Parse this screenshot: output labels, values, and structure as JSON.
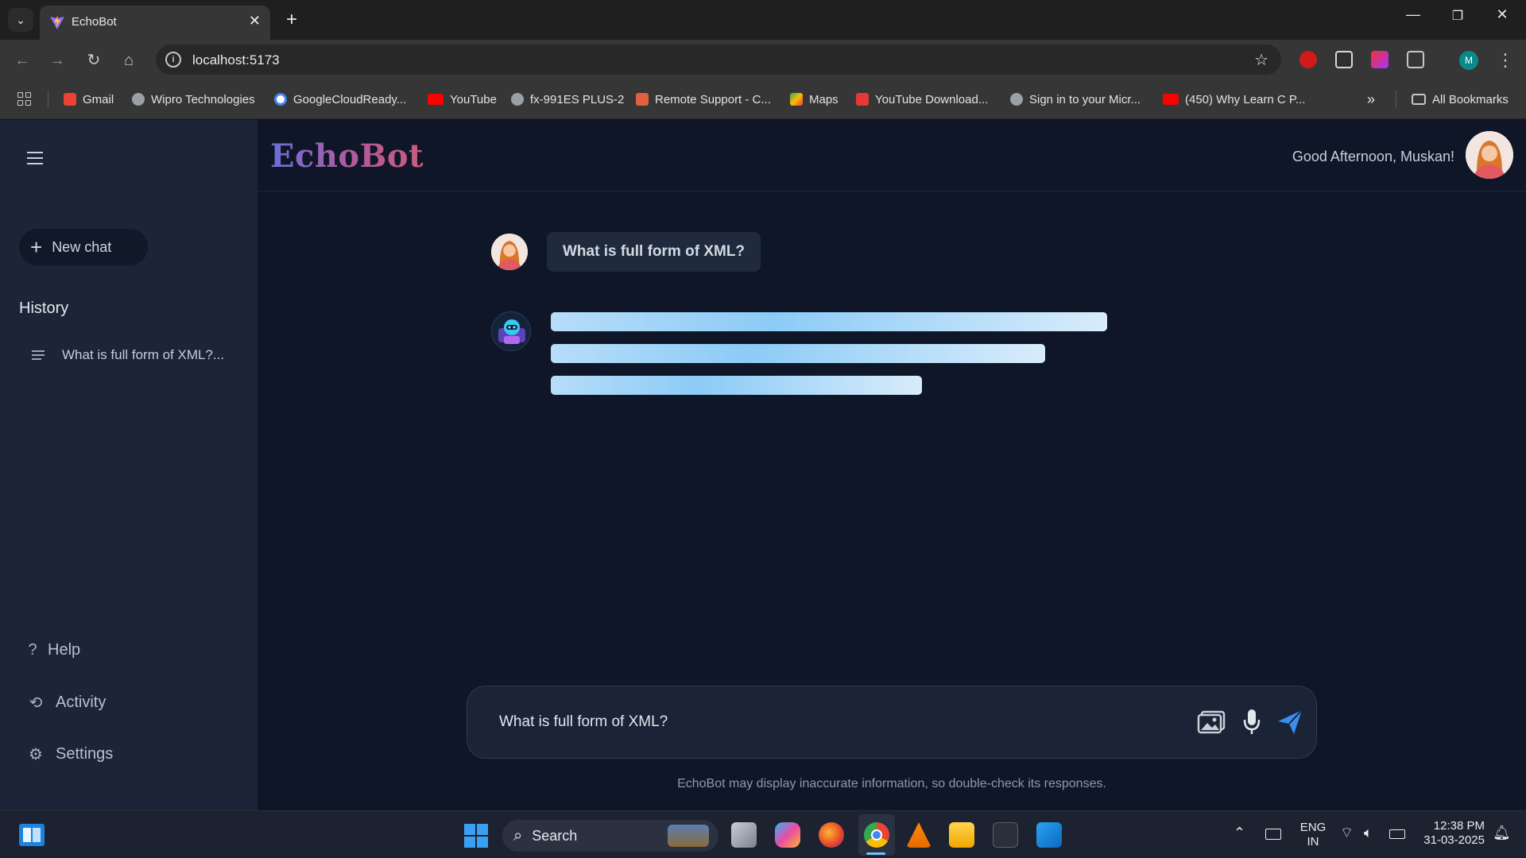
{
  "browser": {
    "tab_title": "EchoBot",
    "url": "localhost:5173",
    "bookmarks": [
      {
        "label": "Gmail",
        "color": "#ea4335"
      },
      {
        "label": "Wipro Technologies",
        "color": "#9aa0a6"
      },
      {
        "label": "GoogleCloudReady...",
        "color": "#4285f4"
      },
      {
        "label": "YouTube",
        "color": "#ff0000"
      },
      {
        "label": "fx-991ES PLUS-2",
        "color": "#9aa0a6"
      },
      {
        "label": "Remote Support - C...",
        "color": "#e06040"
      },
      {
        "label": "Maps",
        "color": "#34a853"
      },
      {
        "label": "YouTube Download...",
        "color": "#e53935"
      },
      {
        "label": "Sign in to your Micr...",
        "color": "#9aa0a6"
      },
      {
        "label": "(450) Why Learn C P...",
        "color": "#ff0000"
      }
    ],
    "all_bookmarks": "All Bookmarks",
    "profile_initial": "M"
  },
  "app": {
    "logo": "EchoBot",
    "greeting": "Good Afternoon, Muskan!",
    "sidebar": {
      "new_chat": "New chat",
      "history_title": "History",
      "history_items": [
        "What is full form of XML?..."
      ],
      "help": "Help",
      "activity": "Activity",
      "settings": "Settings"
    },
    "conversation": {
      "user_message": "What is full form of XML?"
    },
    "input": {
      "value": "What is full form of XML?"
    },
    "disclaimer": "EchoBot may display inaccurate information, so double-check its responses."
  },
  "taskbar": {
    "search": "Search",
    "lang_top": "ENG",
    "lang_bottom": "IN",
    "time": "12:38 PM",
    "date": "31-03-2025"
  },
  "colors": {
    "sidebar_bg": "#1b2537",
    "main_bg": "#0f1628",
    "send_accent": "#3b8ef0"
  }
}
